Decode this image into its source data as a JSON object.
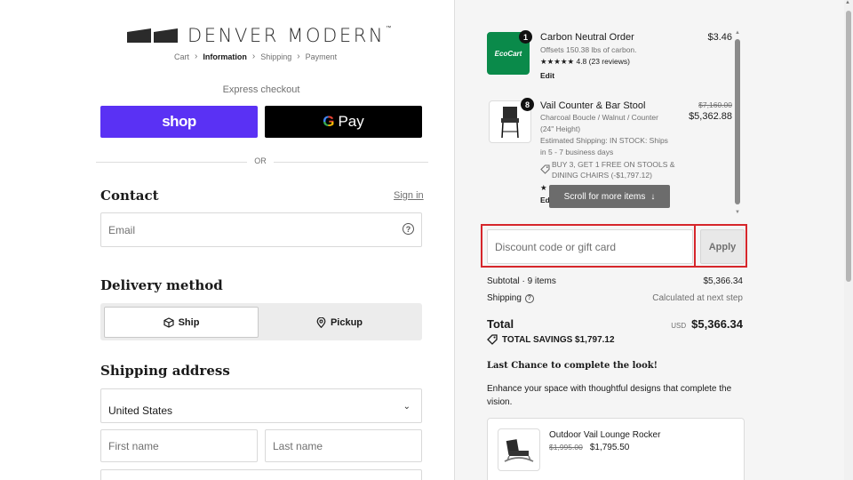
{
  "brand": {
    "name": "DENVER MODERN",
    "tm": "™"
  },
  "breadcrumb": [
    "Cart",
    "Information",
    "Shipping",
    "Payment"
  ],
  "express": {
    "label": "Express checkout",
    "shop_label": "shop",
    "gpay_g": "G",
    "gpay_label": "Pay"
  },
  "divider_or": "OR",
  "contact": {
    "title": "Contact",
    "sign_in": "Sign in",
    "email_placeholder": "Email",
    "help_glyph": "?"
  },
  "delivery": {
    "title": "Delivery method",
    "ship": "Ship",
    "pickup": "Pickup"
  },
  "shipping": {
    "title": "Shipping address",
    "country": "United States",
    "first_name_placeholder": "First name",
    "last_name_placeholder": "Last name"
  },
  "items": [
    {
      "qty": "1",
      "thumb_label": "EcoCart",
      "name": "Carbon Neutral Order",
      "line1": "Offsets 150.38 lbs of carbon.",
      "rating": "★★★★★  4.8 (23 reviews)",
      "edit": "Edit",
      "price": "$3.46"
    },
    {
      "qty": "8",
      "name": "Vail Counter & Bar Stool",
      "line1": "Charcoal Boucle / Walnut / Counter",
      "line2": "(24\" Height)",
      "line3": "Estimated Shipping: IN STOCK: Ships",
      "line4": "in 5 - 7 business days",
      "promo1": "BUY 3, GET 1 FREE ON STOOLS &",
      "promo2": "DINING CHAIRS (-$1,797.12)",
      "star_char": "★",
      "edit": "Ed",
      "compare_price": "$7,160.00",
      "price": "$5,362.88"
    }
  ],
  "scroll_hint": "Scroll for more items",
  "discount": {
    "placeholder": "Discount code or gift card",
    "apply": "Apply"
  },
  "summary": {
    "subtotal_label": "Subtotal · 9 items",
    "subtotal_value": "$5,366.34",
    "shipping_label": "Shipping",
    "shipping_value": "Calculated at next step",
    "total_label": "Total",
    "currency": "USD",
    "total_value": "$5,366.34",
    "savings": "TOTAL SAVINGS  $1,797.12"
  },
  "upsell": {
    "title": "Last Chance to complete the look!",
    "body": "Enhance your space with thoughtful designs that complete the vision.",
    "product": {
      "name": "Outdoor Vail Lounge Rocker",
      "compare_price": "$1,995.00",
      "price": "$1,795.50"
    }
  },
  "colors": {
    "shop": "#5a31f4",
    "ecocart": "#0a8a4a",
    "highlight": "#d6262b"
  }
}
